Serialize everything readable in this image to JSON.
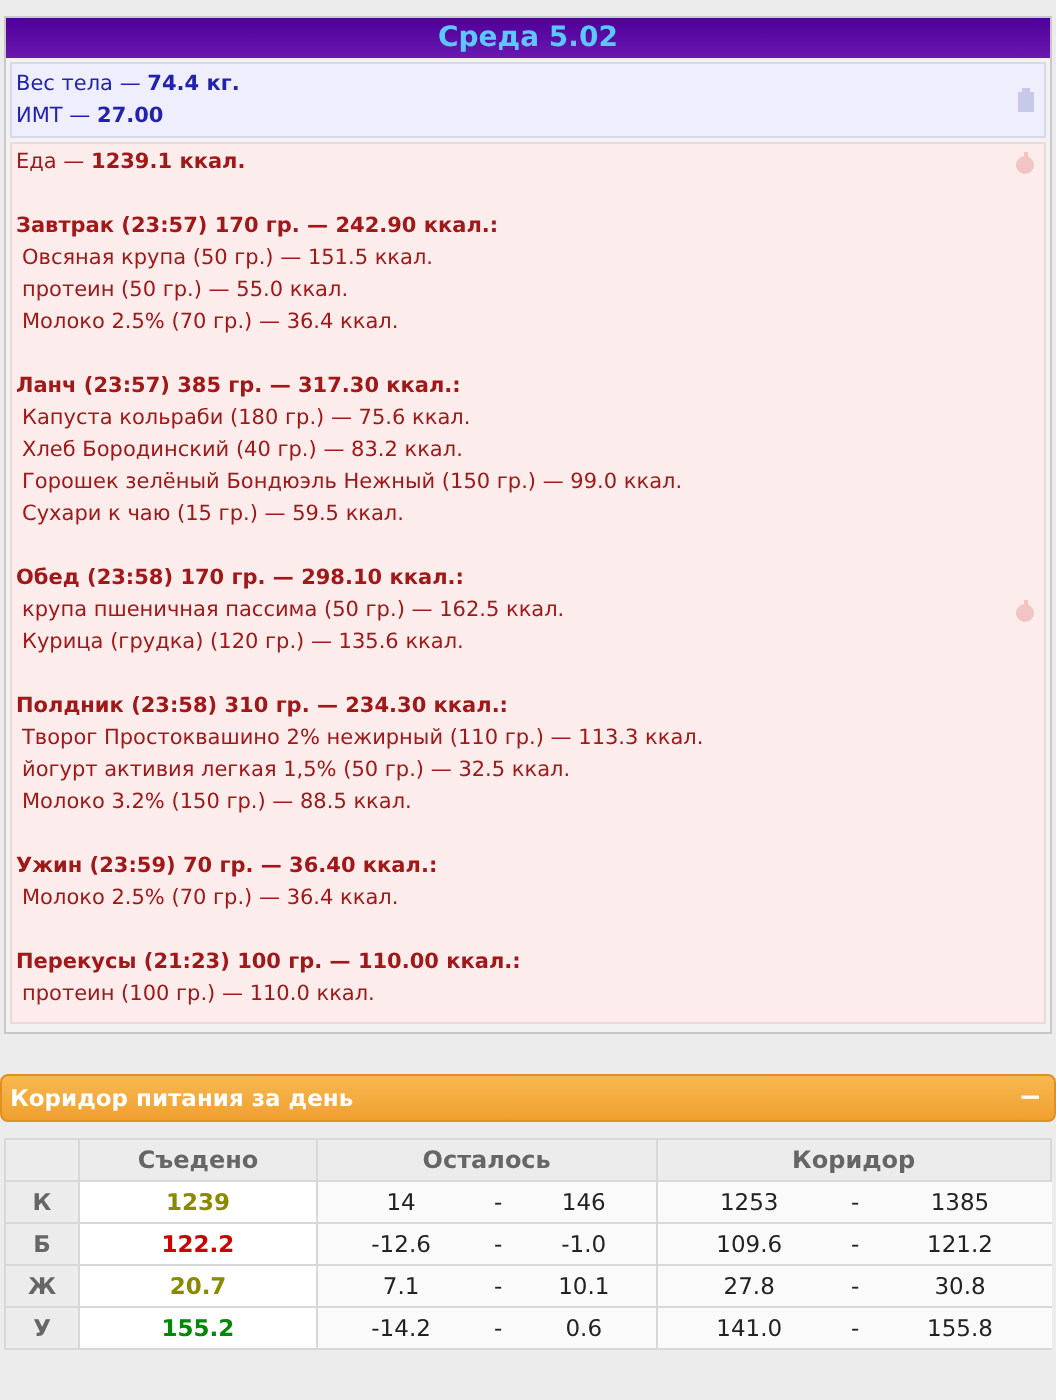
{
  "header": {
    "title": "Среда 5.02"
  },
  "body": {
    "weight": "Вес тела — **74.4 кг.**",
    "bmi": "ИМТ — **27.00**"
  },
  "food": {
    "total": "Еда — **1239.1 ккал.**",
    "meals": [
      {
        "title": "Завтрак (23:57) 170 гр. — 242.90 ккал.:",
        "items": [
          "Овсяная крупа (50 гр.) — 151.5 ккал.",
          "протеин (50 гр.) — 55.0 ккал.",
          "Молоко 2.5% (70 гр.) — 36.4 ккал."
        ]
      },
      {
        "title": "Ланч (23:57) 385 гр. — 317.30 ккал.:",
        "items": [
          "Капуста кольраби (180 гр.) — 75.6 ккал.",
          "Хлеб Бородинский (40 гр.) — 83.2 ккал.",
          "Горошек зелёный Бондюэль Нежный (150 гр.) — 99.0 ккал.",
          "Сухари к чаю (15 гр.) — 59.5 ккал."
        ]
      },
      {
        "title": "Обед (23:58) 170 гр. — 298.10 ккал.:",
        "items": [
          "крупа пшеничная пассима (50 гр.) — 162.5 ккал.",
          "Курица (грудка) (120 гр.) — 135.6 ккал."
        ]
      },
      {
        "title": "Полдник (23:58) 310 гр. — 234.30 ккал.:",
        "items": [
          "Творог Простоквашино 2% нежирный (110 гр.) — 113.3 ккал.",
          "йогурт активия легкая 1,5% (50 гр.) — 32.5 ккал.",
          "Молоко 3.2% (150 гр.) — 88.5 ккал."
        ]
      },
      {
        "title": "Ужин (23:59) 70 гр. — 36.40 ккал.:",
        "items": [
          "Молоко 2.5% (70 гр.) — 36.4 ккал."
        ]
      },
      {
        "title": "Перекусы (21:23) 100 гр. — 110.00 ккал.:",
        "items": [
          "протеин (100 гр.) — 110.0 ккал."
        ]
      }
    ]
  },
  "corridor_panel": {
    "title": "Коридор питания за день",
    "toggle": "−",
    "expanded": true,
    "columns": [
      "Съедено",
      "Осталось",
      "Коридор"
    ],
    "rows": [
      {
        "label": "К",
        "eaten": "1239",
        "color": "#8a8a00",
        "left_min": "14",
        "left_max": "146",
        "range_min": "1253",
        "range_max": "1385"
      },
      {
        "label": "Б",
        "eaten": "122.2",
        "color": "#cc0000",
        "left_min": "-12.6",
        "left_max": "-1.0",
        "range_min": "109.6",
        "range_max": "121.2"
      },
      {
        "label": "Ж",
        "eaten": "20.7",
        "color": "#8a8a00",
        "left_min": "7.1",
        "left_max": "10.1",
        "range_min": "27.8",
        "range_max": "30.8"
      },
      {
        "label": "У",
        "eaten": "155.2",
        "color": "#008800",
        "left_min": "-14.2",
        "left_max": "0.6",
        "range_min": "141.0",
        "range_max": "155.8"
      }
    ],
    "separator": "-"
  }
}
